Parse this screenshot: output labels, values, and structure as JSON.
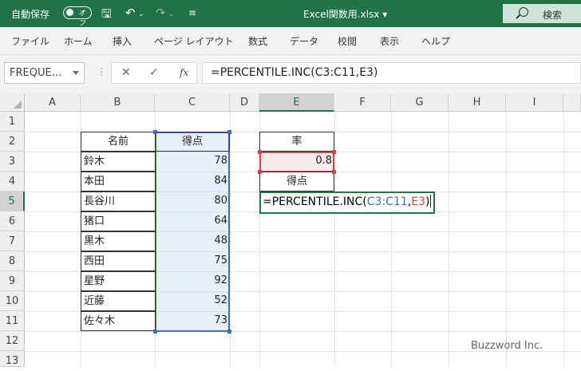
{
  "title_bar": {
    "autosave_label": "自動保存",
    "autosave_state": "オフ",
    "filename": "Excel関数用.xlsx ▾",
    "search_label": "検索",
    "accent_color": "#217346"
  },
  "ribbon": {
    "tabs": [
      "ファイル",
      "ホーム",
      "挿入",
      "ページ レイアウト",
      "数式",
      "データ",
      "校閲",
      "表示",
      "ヘルプ"
    ]
  },
  "formula_bar": {
    "name_box": "FREQUE...",
    "cancel_icon": "✕",
    "enter_icon": "✓",
    "fx_label": "fx",
    "formula": "=PERCENTILE.INC(C3:C11,E3)"
  },
  "sheet": {
    "columns": [
      "A",
      "B",
      "C",
      "D",
      "E",
      "F",
      "G",
      "H",
      "I"
    ],
    "selected_column": "E",
    "rows": [
      "1",
      "2",
      "3",
      "4",
      "5",
      "6",
      "7",
      "8",
      "9",
      "10",
      "11",
      "12",
      "13"
    ],
    "selected_row": "5",
    "table": {
      "header_name": "名前",
      "header_score": "得点",
      "names": [
        "鈴木",
        "本田",
        "長谷川",
        "猪口",
        "黒木",
        "西田",
        "星野",
        "近藤",
        "佐々木"
      ],
      "scores": [
        "78",
        "84",
        "80",
        "64",
        "48",
        "75",
        "92",
        "52",
        "73"
      ]
    },
    "rate_header": "率",
    "rate_value": "0.8",
    "score_header": "得点",
    "edit_cell": {
      "func": "=PERCENTILE.INC(",
      "ref1": "C3:C11",
      "comma": ",",
      "ref2": "E3",
      "close": ")"
    }
  },
  "watermark": "Buzzword Inc."
}
